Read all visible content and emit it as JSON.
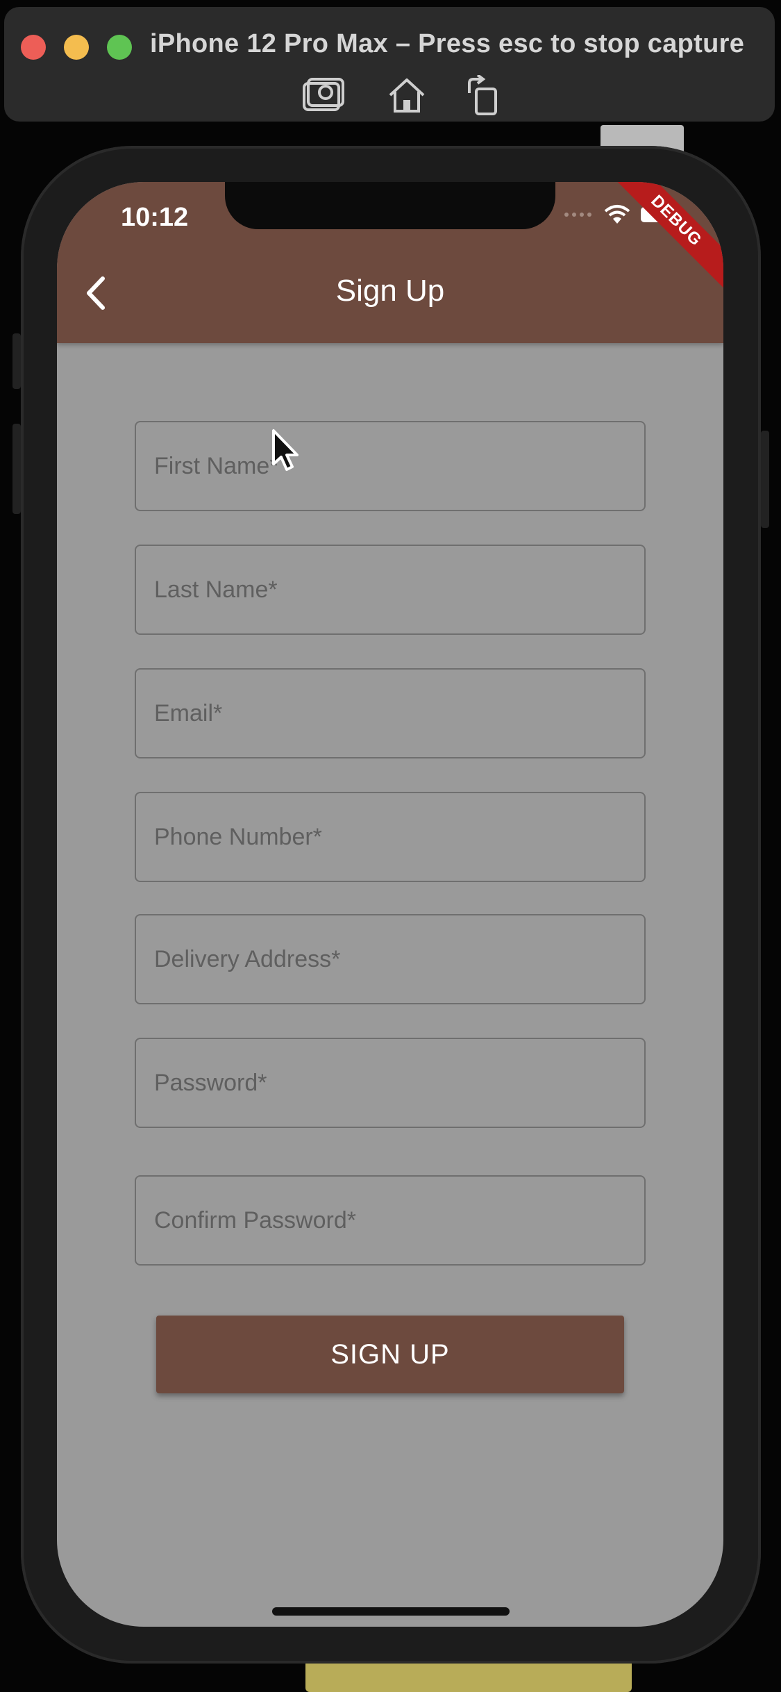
{
  "simulator": {
    "title": "iPhone 12 Pro Max – Press esc to stop capture",
    "buttons": {
      "screenshot_icon": "camera-icon",
      "home_icon": "home-icon",
      "rotate_icon": "rotate-icon"
    }
  },
  "status_bar": {
    "time": "10:12"
  },
  "debug_banner": "DEBUG",
  "app_bar": {
    "title": "Sign Up",
    "back_icon": "chevron-left-icon",
    "color": "#6d4a3e"
  },
  "form": {
    "fields": [
      {
        "placeholder": "First Name*",
        "value": ""
      },
      {
        "placeholder": "Last Name*",
        "value": ""
      },
      {
        "placeholder": "Email*",
        "value": ""
      },
      {
        "placeholder": "Phone Number*",
        "value": ""
      },
      {
        "placeholder": "Delivery Address*",
        "value": ""
      },
      {
        "placeholder": "Password*",
        "value": ""
      },
      {
        "placeholder": "Confirm Password*",
        "value": ""
      }
    ],
    "submit_label": "SIGN UP"
  },
  "colors": {
    "primary": "#6d4a3e",
    "screen_bg": "#9a9a9a",
    "debug": "#b71c1c"
  }
}
